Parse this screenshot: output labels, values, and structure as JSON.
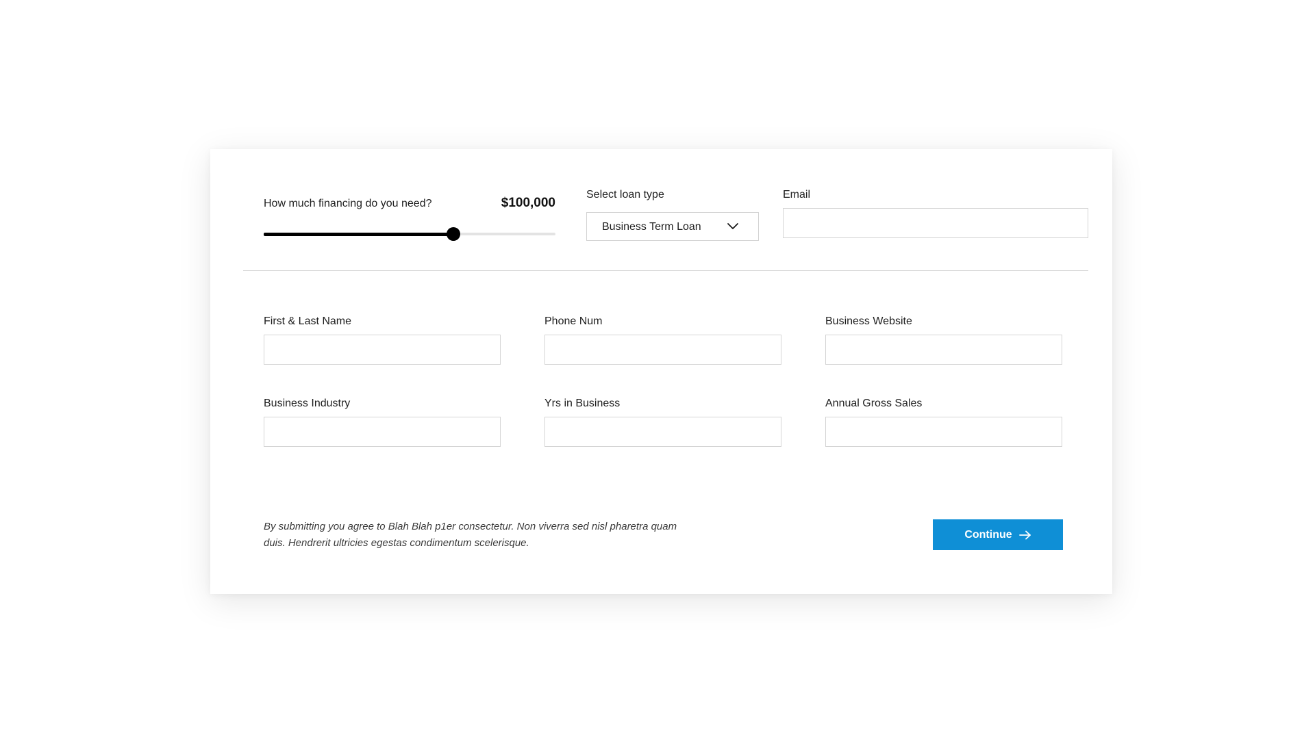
{
  "financing": {
    "label": "How much financing do you need?",
    "amount": "$100,000",
    "slider_fraction": 0.65
  },
  "loan_type": {
    "label": "Select loan type",
    "selected": "Business Term Loan",
    "icon": "chevron-down-icon"
  },
  "email": {
    "label": "Email",
    "value": ""
  },
  "fields": {
    "name": {
      "label": "First & Last Name",
      "value": ""
    },
    "phone": {
      "label": "Phone Num",
      "value": ""
    },
    "website": {
      "label": "Business Website",
      "value": ""
    },
    "industry": {
      "label": "Business Industry",
      "value": ""
    },
    "years": {
      "label": "Yrs in Business",
      "value": ""
    },
    "sales": {
      "label": "Annual Gross Sales",
      "value": ""
    }
  },
  "disclaimer": "By submitting you agree to Blah Blah p1er consectetur. Non viverra sed nisl pharetra quam duis. Hendrerit ultricies egestas condimentum scelerisque.",
  "continue_button": {
    "label": "Continue",
    "icon": "arrow-right-icon",
    "color": "#0f8fd6"
  }
}
